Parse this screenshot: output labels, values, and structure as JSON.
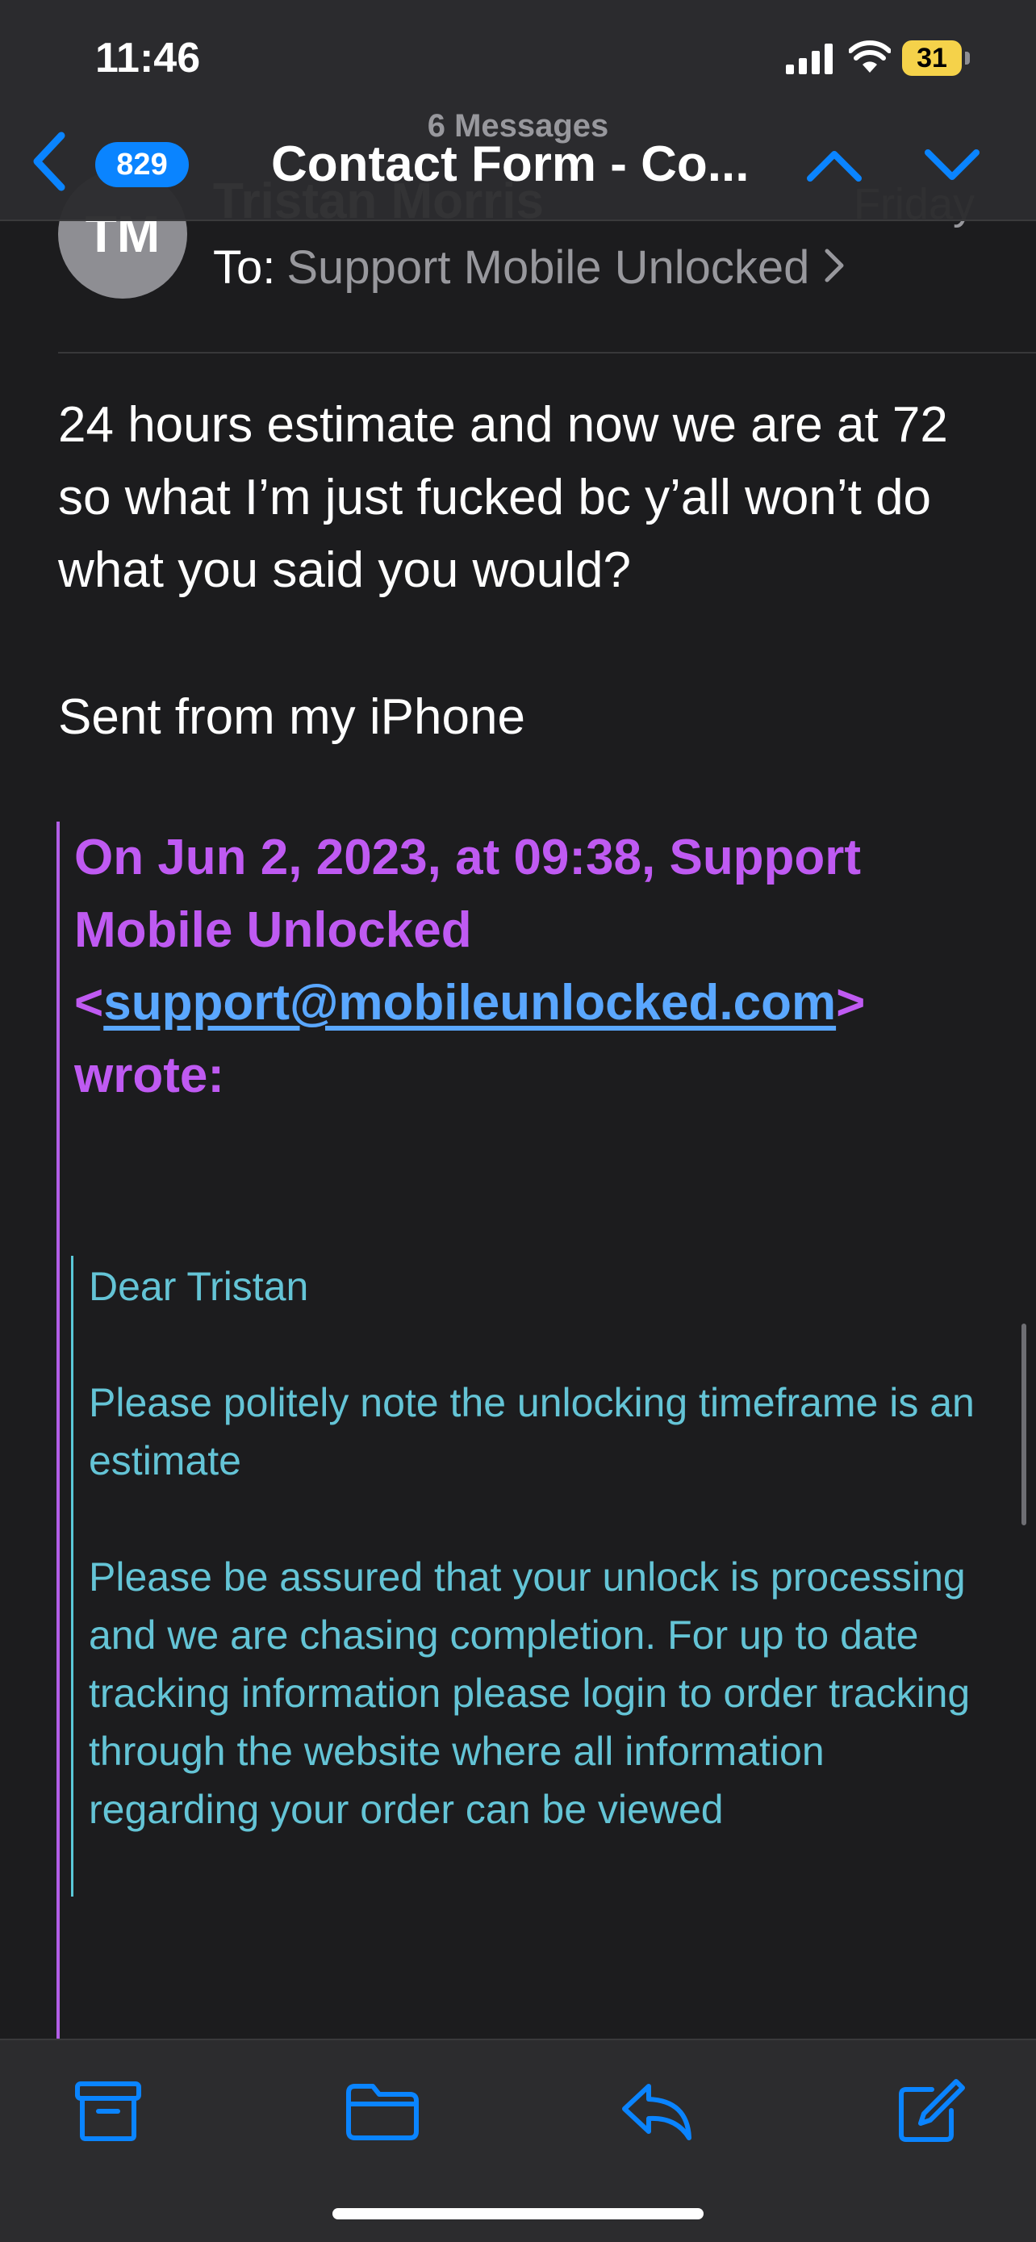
{
  "status_bar": {
    "time": "11:46",
    "battery_percent": "31",
    "battery_color": "#f5d24a"
  },
  "nav": {
    "unread_count": "829",
    "message_count": "6 Messages",
    "title": "Contact Form - Co...",
    "back_icon": "chevron-left-icon",
    "prev_icon": "chevron-up-icon",
    "next_icon": "chevron-down-icon",
    "accent_color": "#0a84ff"
  },
  "message": {
    "avatar_initials": "TM",
    "sender": "Tristan Morris",
    "date": "Friday",
    "to_label": "To:",
    "to_value": "Support Mobile Unlocked",
    "body": "24 hours estimate and now we are at 72 so what I’m just fucked bc y’all won’t do what you said you would?",
    "signature": "Sent from my iPhone"
  },
  "quote": {
    "header_prefix": "On Jun 2, 2023, at 09:38, Support Mobile Unlocked <",
    "header_email": "support@mobileunlocked.com",
    "header_suffix": "> wrote:",
    "color": "#bf5af2",
    "inner_color": "#64c4d6",
    "greeting": "Dear Tristan",
    "paragraph1": "Please politely note the unlocking timeframe is an estimate",
    "paragraph2": "Please be assured that your unlock is processing and we are chasing completion. For up to date tracking information please login to order tracking through the website where all information regarding your order can be viewed"
  },
  "toolbar": {
    "archive_icon": "archive-icon",
    "move_icon": "folder-icon",
    "reply_icon": "reply-icon",
    "compose_icon": "compose-icon"
  }
}
